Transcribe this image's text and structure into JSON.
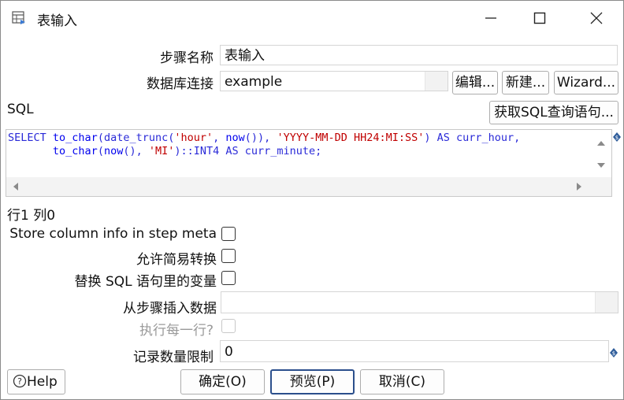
{
  "window": {
    "title": "表输入",
    "icon": "table-input-icon"
  },
  "form": {
    "step_name_label": "步骤名称",
    "step_name_value": "表输入",
    "db_conn_label": "数据库连接",
    "db_conn_value": "example",
    "edit_button": "编辑...",
    "new_button": "新建...",
    "wizard_button": "Wizard...",
    "sql_label": "SQL",
    "get_sql_button": "获取SQL查询语句...",
    "sql_line1_parts": [
      "SELECT ",
      "to_char",
      "(date_trunc(",
      "'hour'",
      ", ",
      "now",
      "()), ",
      "'YYYY-MM-DD HH24:MI:SS'",
      ") AS curr_hour,"
    ],
    "sql_line2_parts": [
      "       ",
      "to_char",
      "(",
      "now",
      "(), ",
      "'MI'",
      ")::INT4 AS curr_minute;"
    ],
    "cursor_position": "行1 列0",
    "store_column_label": "Store column info in step meta",
    "store_column_checked": false,
    "lazy_conversion_label": "允许简易转换",
    "lazy_conversion_checked": false,
    "replace_vars_label": "替换 SQL 语句里的变量",
    "replace_vars_checked": false,
    "insert_from_step_label": "从步骤插入数据",
    "insert_from_step_value": "",
    "execute_each_row_label": "执行每一行?",
    "execute_each_row_checked": false,
    "limit_label": "记录数量限制",
    "limit_value": "0"
  },
  "footer": {
    "help_button": "Help",
    "ok_button": "确定(O)",
    "preview_button": "预览(P)",
    "cancel_button": "取消(C)"
  },
  "colors": {
    "sql_keyword": "#000090",
    "sql_function": "#0000ee",
    "sql_string": "#c00000",
    "focus_border": "#2b4f8c"
  }
}
